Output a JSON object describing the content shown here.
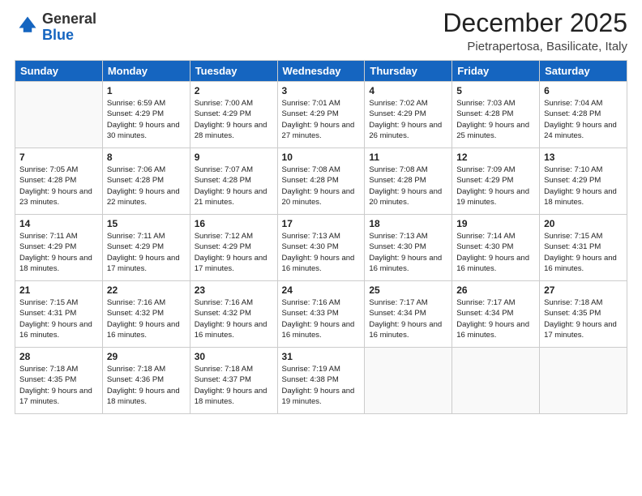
{
  "logo": {
    "general": "General",
    "blue": "Blue"
  },
  "title": "December 2025",
  "location": "Pietrapertosa, Basilicate, Italy",
  "days_header": [
    "Sunday",
    "Monday",
    "Tuesday",
    "Wednesday",
    "Thursday",
    "Friday",
    "Saturday"
  ],
  "weeks": [
    [
      {
        "day": "",
        "sunrise": "",
        "sunset": "",
        "daylight": ""
      },
      {
        "day": "1",
        "sunrise": "Sunrise: 6:59 AM",
        "sunset": "Sunset: 4:29 PM",
        "daylight": "Daylight: 9 hours and 30 minutes."
      },
      {
        "day": "2",
        "sunrise": "Sunrise: 7:00 AM",
        "sunset": "Sunset: 4:29 PM",
        "daylight": "Daylight: 9 hours and 28 minutes."
      },
      {
        "day": "3",
        "sunrise": "Sunrise: 7:01 AM",
        "sunset": "Sunset: 4:29 PM",
        "daylight": "Daylight: 9 hours and 27 minutes."
      },
      {
        "day": "4",
        "sunrise": "Sunrise: 7:02 AM",
        "sunset": "Sunset: 4:29 PM",
        "daylight": "Daylight: 9 hours and 26 minutes."
      },
      {
        "day": "5",
        "sunrise": "Sunrise: 7:03 AM",
        "sunset": "Sunset: 4:28 PM",
        "daylight": "Daylight: 9 hours and 25 minutes."
      },
      {
        "day": "6",
        "sunrise": "Sunrise: 7:04 AM",
        "sunset": "Sunset: 4:28 PM",
        "daylight": "Daylight: 9 hours and 24 minutes."
      }
    ],
    [
      {
        "day": "7",
        "sunrise": "Sunrise: 7:05 AM",
        "sunset": "Sunset: 4:28 PM",
        "daylight": "Daylight: 9 hours and 23 minutes."
      },
      {
        "day": "8",
        "sunrise": "Sunrise: 7:06 AM",
        "sunset": "Sunset: 4:28 PM",
        "daylight": "Daylight: 9 hours and 22 minutes."
      },
      {
        "day": "9",
        "sunrise": "Sunrise: 7:07 AM",
        "sunset": "Sunset: 4:28 PM",
        "daylight": "Daylight: 9 hours and 21 minutes."
      },
      {
        "day": "10",
        "sunrise": "Sunrise: 7:08 AM",
        "sunset": "Sunset: 4:28 PM",
        "daylight": "Daylight: 9 hours and 20 minutes."
      },
      {
        "day": "11",
        "sunrise": "Sunrise: 7:08 AM",
        "sunset": "Sunset: 4:28 PM",
        "daylight": "Daylight: 9 hours and 20 minutes."
      },
      {
        "day": "12",
        "sunrise": "Sunrise: 7:09 AM",
        "sunset": "Sunset: 4:29 PM",
        "daylight": "Daylight: 9 hours and 19 minutes."
      },
      {
        "day": "13",
        "sunrise": "Sunrise: 7:10 AM",
        "sunset": "Sunset: 4:29 PM",
        "daylight": "Daylight: 9 hours and 18 minutes."
      }
    ],
    [
      {
        "day": "14",
        "sunrise": "Sunrise: 7:11 AM",
        "sunset": "Sunset: 4:29 PM",
        "daylight": "Daylight: 9 hours and 18 minutes."
      },
      {
        "day": "15",
        "sunrise": "Sunrise: 7:11 AM",
        "sunset": "Sunset: 4:29 PM",
        "daylight": "Daylight: 9 hours and 17 minutes."
      },
      {
        "day": "16",
        "sunrise": "Sunrise: 7:12 AM",
        "sunset": "Sunset: 4:29 PM",
        "daylight": "Daylight: 9 hours and 17 minutes."
      },
      {
        "day": "17",
        "sunrise": "Sunrise: 7:13 AM",
        "sunset": "Sunset: 4:30 PM",
        "daylight": "Daylight: 9 hours and 16 minutes."
      },
      {
        "day": "18",
        "sunrise": "Sunrise: 7:13 AM",
        "sunset": "Sunset: 4:30 PM",
        "daylight": "Daylight: 9 hours and 16 minutes."
      },
      {
        "day": "19",
        "sunrise": "Sunrise: 7:14 AM",
        "sunset": "Sunset: 4:30 PM",
        "daylight": "Daylight: 9 hours and 16 minutes."
      },
      {
        "day": "20",
        "sunrise": "Sunrise: 7:15 AM",
        "sunset": "Sunset: 4:31 PM",
        "daylight": "Daylight: 9 hours and 16 minutes."
      }
    ],
    [
      {
        "day": "21",
        "sunrise": "Sunrise: 7:15 AM",
        "sunset": "Sunset: 4:31 PM",
        "daylight": "Daylight: 9 hours and 16 minutes."
      },
      {
        "day": "22",
        "sunrise": "Sunrise: 7:16 AM",
        "sunset": "Sunset: 4:32 PM",
        "daylight": "Daylight: 9 hours and 16 minutes."
      },
      {
        "day": "23",
        "sunrise": "Sunrise: 7:16 AM",
        "sunset": "Sunset: 4:32 PM",
        "daylight": "Daylight: 9 hours and 16 minutes."
      },
      {
        "day": "24",
        "sunrise": "Sunrise: 7:16 AM",
        "sunset": "Sunset: 4:33 PM",
        "daylight": "Daylight: 9 hours and 16 minutes."
      },
      {
        "day": "25",
        "sunrise": "Sunrise: 7:17 AM",
        "sunset": "Sunset: 4:34 PM",
        "daylight": "Daylight: 9 hours and 16 minutes."
      },
      {
        "day": "26",
        "sunrise": "Sunrise: 7:17 AM",
        "sunset": "Sunset: 4:34 PM",
        "daylight": "Daylight: 9 hours and 16 minutes."
      },
      {
        "day": "27",
        "sunrise": "Sunrise: 7:18 AM",
        "sunset": "Sunset: 4:35 PM",
        "daylight": "Daylight: 9 hours and 17 minutes."
      }
    ],
    [
      {
        "day": "28",
        "sunrise": "Sunrise: 7:18 AM",
        "sunset": "Sunset: 4:35 PM",
        "daylight": "Daylight: 9 hours and 17 minutes."
      },
      {
        "day": "29",
        "sunrise": "Sunrise: 7:18 AM",
        "sunset": "Sunset: 4:36 PM",
        "daylight": "Daylight: 9 hours and 18 minutes."
      },
      {
        "day": "30",
        "sunrise": "Sunrise: 7:18 AM",
        "sunset": "Sunset: 4:37 PM",
        "daylight": "Daylight: 9 hours and 18 minutes."
      },
      {
        "day": "31",
        "sunrise": "Sunrise: 7:19 AM",
        "sunset": "Sunset: 4:38 PM",
        "daylight": "Daylight: 9 hours and 19 minutes."
      },
      {
        "day": "",
        "sunrise": "",
        "sunset": "",
        "daylight": ""
      },
      {
        "day": "",
        "sunrise": "",
        "sunset": "",
        "daylight": ""
      },
      {
        "day": "",
        "sunrise": "",
        "sunset": "",
        "daylight": ""
      }
    ]
  ]
}
